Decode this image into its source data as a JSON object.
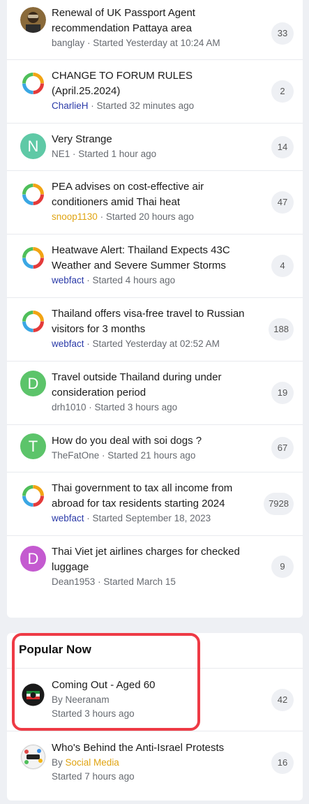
{
  "topics": [
    {
      "title": "Renewal of UK Passport Agent recommendation Pattaya area",
      "author": "banglay",
      "started": "Started Yesterday at 10:24 AM",
      "count": "33",
      "avatar": "photo",
      "author_color": "grey"
    },
    {
      "title": "CHANGE TO FORUM RULES (April.25.2024)",
      "author": "CharlieH",
      "started": "Started 32 minutes ago",
      "count": "2",
      "avatar": "ring",
      "author_color": "blue"
    },
    {
      "title": "Very Strange",
      "author": "NE1",
      "started": "Started 1 hour ago",
      "count": "14",
      "avatar": "letter",
      "letter": "N",
      "avatar_color": "#5fc9a6",
      "author_color": "grey"
    },
    {
      "title": "PEA advises on cost-effective air conditioners amid Thai heat",
      "author": "snoop1130",
      "started": "Started 20 hours ago",
      "count": "47",
      "avatar": "ring",
      "author_color": "gold"
    },
    {
      "title": "Heatwave Alert: Thailand Expects 43C Weather and Severe Summer Storms",
      "author": "webfact",
      "started": "Started 4 hours ago",
      "count": "4",
      "avatar": "ring",
      "author_color": "blue"
    },
    {
      "title": "Thailand offers visa-free travel to Russian visitors for 3 months",
      "author": "webfact",
      "started": "Started Yesterday at 02:52 AM",
      "count": "188",
      "avatar": "ring",
      "author_color": "blue"
    },
    {
      "title": "Travel outside Thailand during under consideration period",
      "author": "drh1010",
      "started": "Started 3 hours ago",
      "count": "19",
      "avatar": "letter",
      "letter": "D",
      "avatar_color": "#5cc46a",
      "author_color": "grey"
    },
    {
      "title": "How do you deal with soi dogs ?",
      "author": "TheFatOne",
      "started": "Started 21 hours ago",
      "count": "67",
      "avatar": "letter",
      "letter": "T",
      "avatar_color": "#5cc46a",
      "author_color": "grey"
    },
    {
      "title": "Thai government to tax all income from abroad for tax residents starting 2024",
      "author": "webfact",
      "started": "Started September 18, 2023",
      "count": "7928",
      "avatar": "ring",
      "author_color": "blue"
    },
    {
      "title": "Thai Viet jet airlines charges for checked luggage",
      "author": "Dean1953",
      "started": "Started March 15",
      "count": "9",
      "avatar": "letter",
      "letter": "D",
      "avatar_color": "#c45ad0",
      "author_color": "grey"
    }
  ],
  "popular": {
    "heading": "Popular Now",
    "items": [
      {
        "title": "Coming Out - Aged 60",
        "by": "By",
        "author": "Neeranam",
        "started": "Started 3 hours ago",
        "count": "42",
        "avatar": "badge",
        "author_color": "grey"
      },
      {
        "title": "Who's Behind the Anti-Israel Protests",
        "by": "By",
        "author": "Social Media",
        "started": "Started 7 hours ago",
        "count": "16",
        "avatar": "social",
        "author_color": "gold"
      }
    ]
  },
  "colors": {
    "highlight": "#ee3a45",
    "link_blue": "#2a3aa8",
    "link_gold": "#e0a412"
  }
}
